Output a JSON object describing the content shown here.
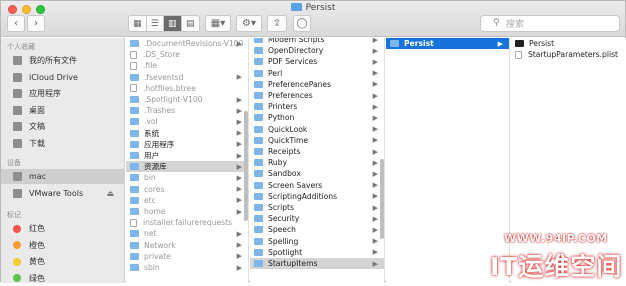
{
  "window": {
    "title": "Persist"
  },
  "toolbar": {
    "back": "‹",
    "forward": "›",
    "search_placeholder": "搜索"
  },
  "sidebar": {
    "favorites_header": "个人收藏",
    "favorites": [
      {
        "label": "我的所有文件",
        "icon": "all-files-icon"
      },
      {
        "label": "iCloud Drive",
        "icon": "cloud-icon"
      },
      {
        "label": "应用程序",
        "icon": "applications-icon"
      },
      {
        "label": "桌面",
        "icon": "desktop-icon"
      },
      {
        "label": "文稿",
        "icon": "documents-icon"
      },
      {
        "label": "下载",
        "icon": "downloads-icon"
      }
    ],
    "devices_header": "设备",
    "devices": [
      {
        "label": "mac",
        "icon": "harddisk-icon"
      },
      {
        "label": "VMware Tools",
        "icon": "disc-icon"
      }
    ],
    "tags_header": "标记",
    "tags": [
      {
        "label": "红色",
        "color": "#f0544c"
      },
      {
        "label": "橙色",
        "color": "#f79c30"
      },
      {
        "label": "黄色",
        "color": "#f3cc31"
      },
      {
        "label": "绿色",
        "color": "#5cc44b"
      }
    ]
  },
  "columns": {
    "col1": [
      {
        "label": ".DocumentRevisions-V100",
        "kind": "folder",
        "hidden": true,
        "arrow": true
      },
      {
        "label": ".DS_Store",
        "kind": "file",
        "hidden": true
      },
      {
        "label": ".file",
        "kind": "file",
        "hidden": true
      },
      {
        "label": ".fseventsd",
        "kind": "folder",
        "hidden": true,
        "arrow": true
      },
      {
        "label": ".hotfiles.btree",
        "kind": "file",
        "hidden": true
      },
      {
        "label": ".Spotlight-V100",
        "kind": "folder",
        "hidden": true,
        "arrow": true
      },
      {
        "label": ".Trashes",
        "kind": "folder",
        "hidden": true,
        "arrow": true
      },
      {
        "label": ".vol",
        "kind": "folder",
        "hidden": true,
        "arrow": true
      },
      {
        "label": "系统",
        "kind": "folder",
        "arrow": true
      },
      {
        "label": "应用程序",
        "kind": "folder",
        "arrow": true
      },
      {
        "label": "用户",
        "kind": "folder",
        "arrow": true
      },
      {
        "label": "资源库",
        "kind": "folder",
        "arrow": true,
        "selected": true
      },
      {
        "label": "bin",
        "kind": "folder",
        "hidden": true,
        "arrow": true
      },
      {
        "label": "cores",
        "kind": "folder",
        "hidden": true,
        "arrow": true
      },
      {
        "label": "etc",
        "kind": "folder",
        "hidden": true,
        "arrow": true
      },
      {
        "label": "home",
        "kind": "folder",
        "hidden": true,
        "arrow": true
      },
      {
        "label": "installer.failurerequests",
        "kind": "file",
        "hidden": true
      },
      {
        "label": "net",
        "kind": "folder",
        "hidden": true,
        "arrow": true
      },
      {
        "label": "Network",
        "kind": "folder",
        "hidden": true,
        "arrow": true
      },
      {
        "label": "private",
        "kind": "folder",
        "hidden": true,
        "arrow": true
      },
      {
        "label": "sbin",
        "kind": "folder",
        "hidden": true,
        "arrow": true
      }
    ],
    "col2": [
      {
        "label": "Modem Scripts",
        "kind": "folder",
        "arrow": true
      },
      {
        "label": "OpenDirectory",
        "kind": "folder",
        "arrow": true
      },
      {
        "label": "PDF Services",
        "kind": "folder",
        "arrow": true
      },
      {
        "label": "Perl",
        "kind": "folder",
        "arrow": true
      },
      {
        "label": "PreferencePanes",
        "kind": "folder",
        "arrow": true
      },
      {
        "label": "Preferences",
        "kind": "folder",
        "arrow": true
      },
      {
        "label": "Printers",
        "kind": "folder",
        "arrow": true
      },
      {
        "label": "Python",
        "kind": "folder",
        "arrow": true
      },
      {
        "label": "QuickLook",
        "kind": "folder",
        "arrow": true
      },
      {
        "label": "QuickTime",
        "kind": "folder",
        "arrow": true
      },
      {
        "label": "Receipts",
        "kind": "folder",
        "arrow": true
      },
      {
        "label": "Ruby",
        "kind": "folder",
        "arrow": true
      },
      {
        "label": "Sandbox",
        "kind": "folder",
        "arrow": true
      },
      {
        "label": "Screen Savers",
        "kind": "folder",
        "arrow": true
      },
      {
        "label": "ScriptingAdditions",
        "kind": "folder",
        "arrow": true
      },
      {
        "label": "Scripts",
        "kind": "folder",
        "arrow": true
      },
      {
        "label": "Security",
        "kind": "folder",
        "arrow": true
      },
      {
        "label": "Speech",
        "kind": "folder",
        "arrow": true
      },
      {
        "label": "Spelling",
        "kind": "folder",
        "arrow": true
      },
      {
        "label": "Spotlight",
        "kind": "folder",
        "arrow": true
      },
      {
        "label": "StartupItems",
        "kind": "folder",
        "arrow": true,
        "selected": true
      }
    ],
    "col3": [
      {
        "label": "Persist",
        "kind": "folder",
        "arrow": true,
        "active": true
      }
    ],
    "col4": [
      {
        "label": "Persist",
        "kind": "exec"
      },
      {
        "label": "StartupParameters.plist",
        "kind": "file"
      }
    ]
  },
  "watermark": {
    "url": "WWW.94IP.COM",
    "brand": "IT运维空间"
  },
  "colors": {
    "selection": "#1673dd",
    "folder": "#7fb6ea",
    "sidebar": "#eaeaeb"
  }
}
